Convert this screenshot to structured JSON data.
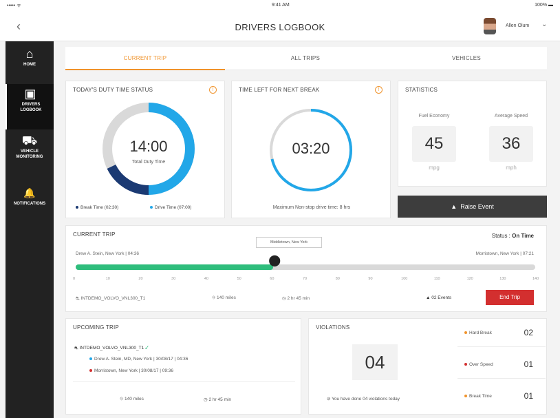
{
  "statusbar": {
    "left": "••••• ᯤ",
    "time": "9:41 AM",
    "right": "100% ▬"
  },
  "header": {
    "title": "DRIVERS LOGBOOK",
    "user": "Allen Olum"
  },
  "sidebar": {
    "items": [
      {
        "label": "HOME",
        "icon": "home-icon",
        "glyph": "⌂"
      },
      {
        "label": "DRIVERS LOGBOOK",
        "icon": "logbook-icon",
        "glyph": "▣"
      },
      {
        "label": "VEHICLE MONITORING",
        "icon": "truck-icon",
        "glyph": "⛟"
      },
      {
        "label": "NOTIFICATIONS",
        "icon": "bell-icon",
        "glyph": "🔔"
      }
    ]
  },
  "tabs": [
    "CURRENT TRIP",
    "ALL TRIPS",
    "VEHICLES"
  ],
  "duty": {
    "title": "TODAY'S DUTY TIME STATUS",
    "value": "14:00",
    "sub": "Total Duty Time",
    "legend_break": "Break Time (02:30)",
    "legend_drive": "Drive Time (07:00)",
    "colors": {
      "drive": "#22a7e8",
      "break": "#1b3a73",
      "rest": "#d9d9d9"
    }
  },
  "next_break": {
    "title": "TIME LEFT FOR NEXT BREAK",
    "value": "03:20",
    "footer": "Maximum Non-stop drive time: 8 hrs"
  },
  "statistics": {
    "title": "STATISTICS",
    "fuel_label": "Fuel Economy",
    "fuel_value": "45",
    "fuel_unit": "mpg",
    "speed_label": "Average Speed",
    "speed_value": "36",
    "speed_unit": "mph"
  },
  "raise_event": "Raise Event",
  "current_trip": {
    "title": "CURRENT TRIP",
    "status_label": "Status :",
    "status_value": "On Time",
    "origin": "Drew A. Stein, New York | 04:36",
    "destination": "Morristown, New York | 07:21",
    "marker_label": "Middletown, New York",
    "progress": 0.43,
    "ticks": [
      "0",
      "10",
      "20",
      "30",
      "40",
      "50",
      "60",
      "70",
      "80",
      "90",
      "100",
      "110",
      "120",
      "130",
      "140"
    ],
    "vehicle": "INTDEMO_VOLVO_VNL300_T1",
    "distance": "140 miles",
    "duration": "2 hr 45 min",
    "events": "02 Events",
    "end_trip": "End Trip",
    "progress_color": "#2ebd7c"
  },
  "upcoming": {
    "title": "UPCOMING TRIP",
    "vehicle": "INTDEMO_VOLVO_VNL300_T1",
    "stop1": "Drew A. Stein, MD, New York | 30/08/17 | 04:36",
    "stop2": "Morristown, New York | 30/08/17 | 09:36",
    "distance": "140 miles",
    "duration": "2 hr 45 min"
  },
  "violations": {
    "title": "VIOLATIONS",
    "count": "04",
    "note": "You have done 04 violations today",
    "items": [
      {
        "name": "Hard Break",
        "count": "02",
        "color": "#f0932b"
      },
      {
        "name": "Over Speed",
        "count": "01",
        "color": "#d32f2f"
      },
      {
        "name": "Break Time",
        "count": "01",
        "color": "#f0932b"
      }
    ]
  }
}
